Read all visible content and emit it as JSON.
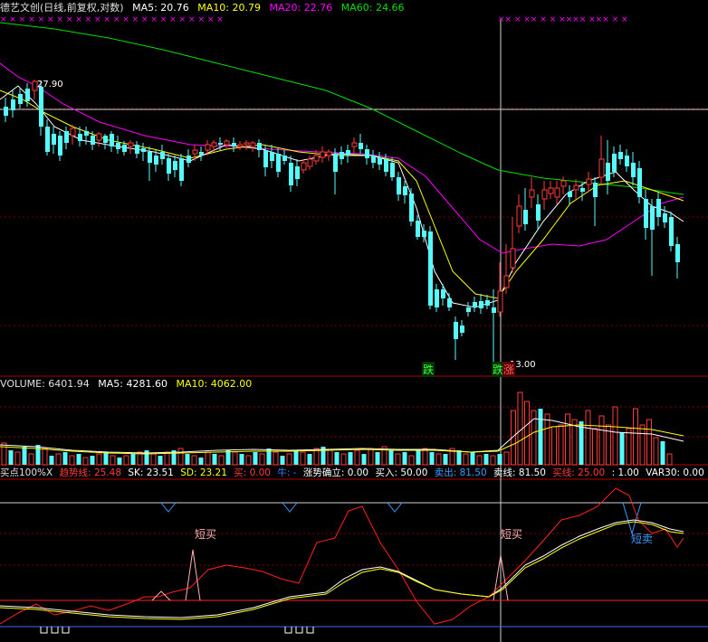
{
  "price_header": {
    "title": "德艺文创(日线,前复权,对数)",
    "ma5": "MA5: 20.76",
    "ma10": "MA10: 20.79",
    "ma20": "MA20: 22.76",
    "ma60": "MA60: 24.66"
  },
  "price_labels": {
    "high": "27.90",
    "low": "13.00",
    "die": "跌",
    "zhang": "涨",
    "cursor_tag": "跌"
  },
  "volume_header": {
    "volume": "VOLUME: 6401.94",
    "ma5": "MA5: 4281.60",
    "ma10": "MA10: 4062.00"
  },
  "indicator_header": {
    "name": "买点100%X",
    "trend": "趋势线: 25.48",
    "sk": "SK: 23.51",
    "sd": "SD: 23.21",
    "buy0": "买: 0.00",
    "niu": "牛: -",
    "trend_confirm": "涨势确立: 0.00",
    "buyin": "买入: 50.00",
    "sellout": "卖出: 81.50",
    "sell_line": "卖线: 81.50",
    "buy_line": "买线: 25.00",
    "ratio": ": 1.00",
    "var30": "VAR30: 0.00"
  },
  "indicator_labels": {
    "short_buy_1": "短买",
    "short_buy_2": "短买",
    "short_sell": "短卖"
  },
  "colors": {
    "up": "#ff3b3b",
    "down": "#54fcfc",
    "ma5": "#ffffff",
    "ma10": "#ffff00",
    "ma20": "#ff00ff",
    "ma60": "#00e000",
    "grid": "#8b0000"
  }
}
